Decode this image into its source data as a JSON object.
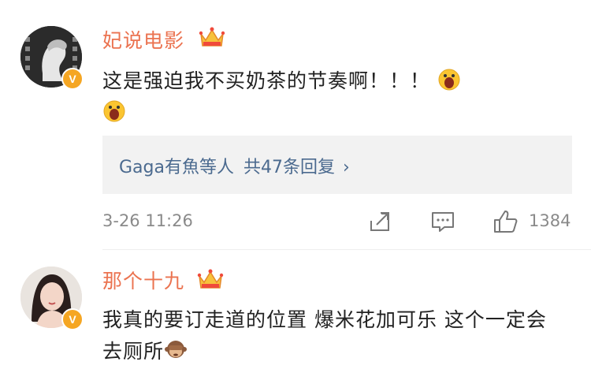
{
  "comments": [
    {
      "username": "妃说电影",
      "text": "这是强迫我不买奶茶的节奏啊！！！",
      "emoji_after": "scream-emoji",
      "replies": {
        "names": "Gaga有魚等人",
        "count_text": "共47条回复",
        "chevron": "›"
      },
      "timestamp": "3-26 11:26",
      "like_count": "1384",
      "verified_badge": "V"
    },
    {
      "username": "那个十九",
      "text": "我真的要订走道的位置 爆米花加可乐 这个一定会去厕所",
      "emoji_after": "see-no-evil-monkey-emoji",
      "verified_badge": "V"
    }
  ],
  "colors": {
    "username": "#eb7350",
    "reply_link": "#4b6a8f",
    "meta": "#8a8a8a",
    "reply_bg": "#f2f2f2",
    "badge": "#f5a623"
  }
}
